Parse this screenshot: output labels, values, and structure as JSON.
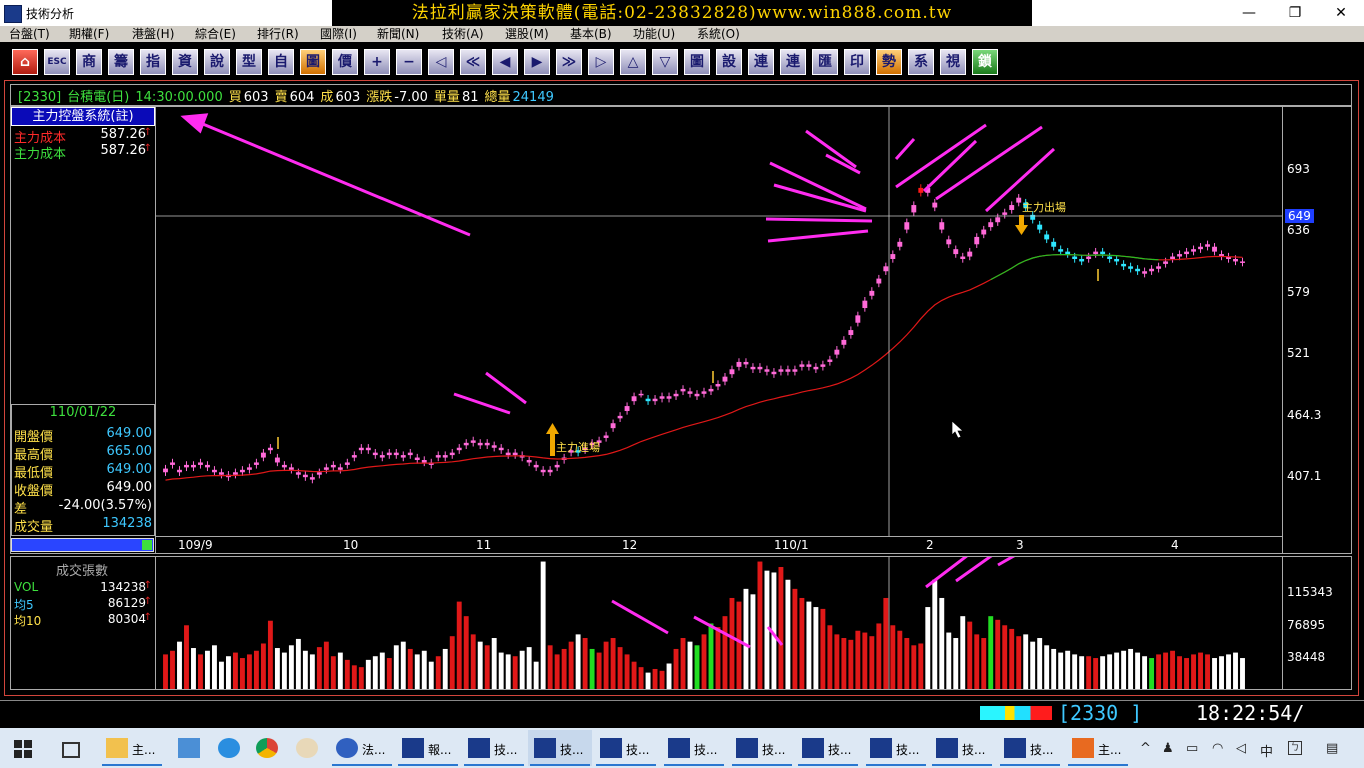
{
  "window": {
    "title": "技術分析",
    "banner": "法拉利贏家決策軟體(電話:02-23832828)www.win888.com.tw",
    "controls": [
      "—",
      "❐",
      "✕"
    ]
  },
  "menu": [
    "台盤(T)",
    "期權(F)",
    "港盤(H)",
    "綜合(E)",
    "排行(R)",
    "國際(I)",
    "新聞(N)",
    "技術(A)",
    "選股(M)",
    "基本(B)",
    "功能(U)",
    "系統(O)"
  ],
  "toolbar": [
    "⌂",
    "ESC",
    "商",
    "籌",
    "指",
    "資",
    "說",
    "型",
    "自",
    "圖",
    "價",
    "+",
    "−",
    "◁",
    "≪",
    "◀",
    "▶",
    "≫",
    "▷",
    "△",
    "▽",
    "圖",
    "設",
    "連",
    "連",
    "匯",
    "印",
    "勢",
    "系",
    "視",
    "鎖"
  ],
  "stock": {
    "code": "[2330]",
    "name": "台積電(日)",
    "time": "14:30:00.000",
    "bid_label": "買",
    "bid": "603",
    "ask_label": "賣",
    "ask": "604",
    "deal_label": "成",
    "deal": "603",
    "change_label": "漲跌",
    "change": "-7.00",
    "unit_vol_label": "單量",
    "unit_vol": "81",
    "total_vol_label": "總量",
    "total_vol": "24149"
  },
  "system": {
    "title": "主力控盤系統(註)",
    "rows": [
      {
        "label": "主力成本",
        "value": "587.26",
        "color": "#ff2a2a"
      },
      {
        "label": "主力成本",
        "value": "587.26",
        "color": "#3ee03e"
      }
    ]
  },
  "ohlc": {
    "date": "110/01/22",
    "rows": [
      {
        "label": "開盤價",
        "value": "649.00",
        "color": "#3ec8ff"
      },
      {
        "label": "最高價",
        "value": "665.00",
        "color": "#3ec8ff"
      },
      {
        "label": "最低價",
        "value": "649.00",
        "color": "#3ec8ff"
      },
      {
        "label": "收盤價",
        "value": "649.00",
        "color": "#ffffff"
      },
      {
        "label": "差",
        "value": "-24.00(3.57%)",
        "color": "#ffffff"
      },
      {
        "label": "成交量",
        "value": "134238",
        "color": "#3ec8ff"
      }
    ]
  },
  "price_axis": {
    "labels": [
      {
        "text": "693",
        "value": 693
      },
      {
        "text": "636",
        "value": 636
      },
      {
        "text": "579",
        "value": 579
      },
      {
        "text": "521",
        "value": 521
      },
      {
        "text": "464.3",
        "value": 464.3
      },
      {
        "text": "407.1",
        "value": 407.1
      }
    ],
    "current": "649"
  },
  "time_axis": [
    "109/9",
    "10",
    "11",
    "12",
    "110/1",
    "2",
    "3",
    "4"
  ],
  "annotations": {
    "enter": "主力進場",
    "exit": "主力出場"
  },
  "volume": {
    "title": "成交張數",
    "rows": [
      {
        "label": "VOL",
        "value": "134238",
        "color": "#3ee03e"
      },
      {
        "label": "均5",
        "value": "86129",
        "color": "#3ec8ff"
      },
      {
        "label": "均10",
        "value": "80304",
        "color": "#ffe14a"
      }
    ],
    "axis": [
      {
        "text": "115343",
        "value": 115343
      },
      {
        "text": "76895",
        "value": 76895
      },
      {
        "text": "38448",
        "value": 38448
      }
    ]
  },
  "chart_data": {
    "type": "candlestick",
    "title": "台積電(日)",
    "ylim": [
      380,
      730
    ],
    "volume_ylim": [
      0,
      145000
    ],
    "x_labels": [
      "109/9",
      "10",
      "11",
      "12",
      "110/1",
      "2",
      "3",
      "4"
    ],
    "close": [
      435,
      440,
      432,
      438,
      436,
      440,
      436,
      432,
      430,
      428,
      432,
      434,
      436,
      440,
      448,
      452,
      440,
      436,
      434,
      430,
      428,
      426,
      432,
      436,
      438,
      434,
      440,
      446,
      452,
      450,
      446,
      444,
      448,
      446,
      444,
      448,
      442,
      440,
      438,
      446,
      444,
      448,
      452,
      456,
      458,
      454,
      456,
      452,
      450,
      446,
      448,
      444,
      440,
      436,
      432,
      434,
      438,
      444,
      450,
      448,
      452,
      456,
      458,
      462,
      472,
      478,
      486,
      494,
      496,
      490,
      492,
      494,
      492,
      496,
      500,
      496,
      494,
      498,
      500,
      504,
      510,
      516,
      522,
      520,
      516,
      518,
      514,
      512,
      516,
      514,
      516,
      520,
      518,
      516,
      520,
      524,
      532,
      540,
      548,
      560,
      572,
      580,
      590,
      600,
      610,
      620,
      636,
      650,
      664,
      660,
      648,
      630,
      618,
      610,
      606,
      612,
      624,
      630,
      636,
      640,
      644,
      650,
      656,
      648,
      638,
      630,
      622,
      616,
      612,
      610,
      606,
      604,
      608,
      612,
      610,
      606,
      604,
      600,
      598,
      596,
      594,
      598,
      600,
      604,
      608,
      610,
      612,
      614,
      616,
      618,
      612,
      608,
      606,
      604,
      603
    ],
    "open": [
      432,
      438,
      434,
      436,
      438,
      438,
      438,
      434,
      432,
      430,
      430,
      432,
      434,
      438,
      444,
      450,
      444,
      438,
      436,
      432,
      430,
      428,
      430,
      434,
      436,
      436,
      438,
      444,
      450,
      452,
      448,
      446,
      446,
      448,
      446,
      446,
      444,
      442,
      440,
      444,
      446,
      446,
      450,
      454,
      456,
      456,
      454,
      454,
      452,
      448,
      446,
      446,
      442,
      438,
      434,
      432,
      436,
      442,
      448,
      450,
      450,
      454,
      456,
      460,
      468,
      476,
      482,
      490,
      496,
      492,
      490,
      492,
      494,
      494,
      498,
      498,
      496,
      496,
      498,
      502,
      506,
      512,
      518,
      522,
      518,
      516,
      516,
      514,
      514,
      516,
      514,
      518,
      520,
      518,
      518,
      522,
      528,
      536,
      544,
      554,
      566,
      576,
      586,
      596,
      606,
      616,
      630,
      644,
      660,
      664,
      652,
      636,
      622,
      614,
      608,
      608,
      618,
      626,
      632,
      636,
      642,
      646,
      652,
      652,
      642,
      634,
      626,
      620,
      614,
      612,
      608,
      606,
      606,
      610,
      612,
      608,
      606,
      602,
      600,
      598,
      596,
      596,
      598,
      602,
      606,
      608,
      610,
      612,
      614,
      616,
      616,
      610,
      608,
      606,
      604
    ],
    "volume": [
      38000,
      42000,
      52000,
      70000,
      45000,
      38000,
      42000,
      48000,
      30000,
      36000,
      40000,
      34000,
      38000,
      42000,
      50000,
      75000,
      45000,
      40000,
      48000,
      55000,
      42000,
      38000,
      46000,
      52000,
      36000,
      40000,
      32000,
      26000,
      24000,
      32000,
      36000,
      40000,
      34000,
      48000,
      52000,
      44000,
      38000,
      42000,
      30000,
      36000,
      44000,
      58000,
      96000,
      80000,
      60000,
      52000,
      48000,
      56000,
      40000,
      38000,
      36000,
      42000,
      46000,
      30000,
      140000,
      48000,
      38000,
      44000,
      52000,
      60000,
      56000,
      44000,
      40000,
      52000,
      56000,
      46000,
      38000,
      30000,
      24000,
      18000,
      22000,
      20000,
      28000,
      44000,
      56000,
      52000,
      48000,
      60000,
      72000,
      68000,
      80000,
      100000,
      96000,
      110000,
      104000,
      140000,
      130000,
      128000,
      134000,
      120000,
      110000,
      100000,
      96000,
      90000,
      88000,
      70000,
      60000,
      56000,
      54000,
      64000,
      62000,
      58000,
      72000,
      100000,
      70000,
      64000,
      56000,
      48000,
      50000,
      90000,
      120000,
      100000,
      62000,
      56000,
      80000,
      74000,
      60000,
      56000,
      80000,
      76000,
      70000,
      66000,
      58000,
      60000,
      52000,
      56000,
      48000,
      44000,
      40000,
      42000,
      38000,
      36000,
      36000,
      34000,
      36000,
      38000,
      40000,
      42000,
      44000,
      40000,
      36000,
      34000,
      38000,
      40000,
      42000,
      36000,
      34000,
      38000,
      40000,
      38000,
      34000,
      36000,
      38000,
      40000,
      34000
    ],
    "cost_line_label": "主力成本",
    "cost_line_value": 587.26
  }
}
